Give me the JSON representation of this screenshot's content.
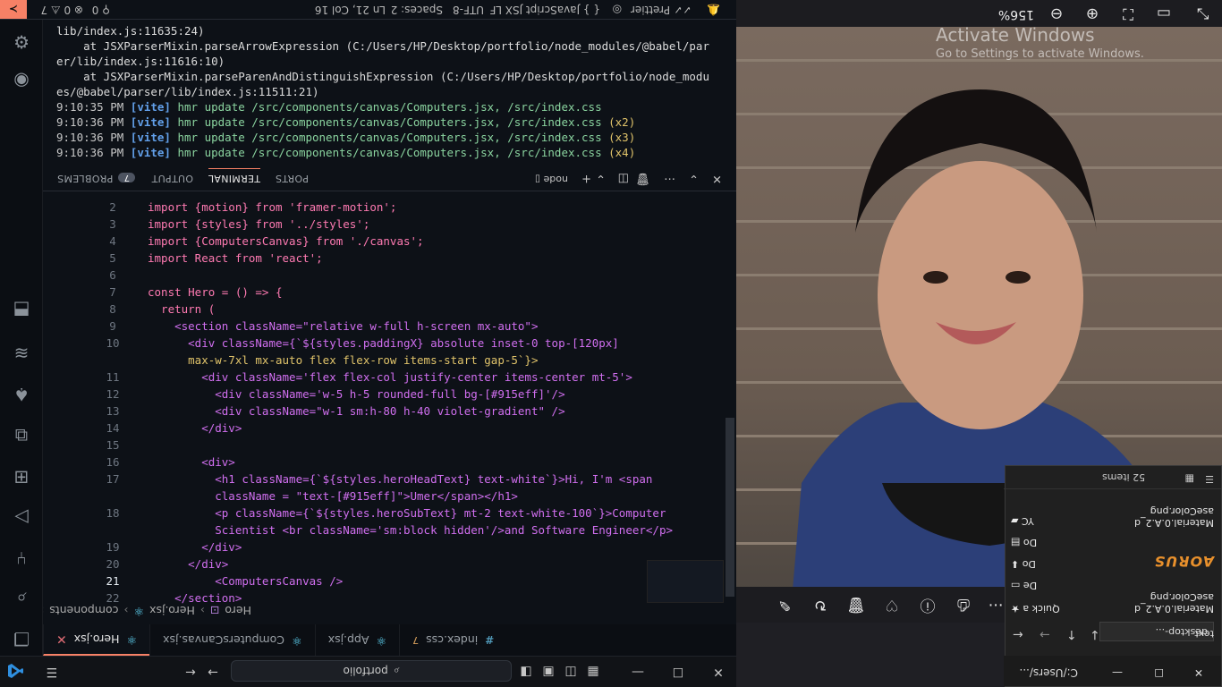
{
  "vscode": {
    "search_text": "portfolio",
    "tabs": [
      {
        "label": "Hero.jsx",
        "active": true
      },
      {
        "label": "ComputersCanvas.jsx"
      },
      {
        "label": "App.jsx"
      },
      {
        "label": "index.css",
        "modified": "7"
      }
    ],
    "breadcrumb": [
      "src",
      "components",
      "Hero.jsx",
      "Hero"
    ],
    "code": [
      {
        "n": "2",
        "text": "import {motion} from 'framer-motion';"
      },
      {
        "n": "3",
        "text": "import {styles} from '../styles';"
      },
      {
        "n": "4",
        "text": "import {ComputersCanvas} from './canvas';"
      },
      {
        "n": "5",
        "text": "import React from 'react';"
      },
      {
        "n": "6",
        "text": ""
      },
      {
        "n": "7",
        "text": "const Hero = () => {"
      },
      {
        "n": "8",
        "text": "  return ("
      },
      {
        "n": "9",
        "text": "    <section className=\"relative w-full h-screen mx-auto\">"
      },
      {
        "n": "10",
        "text": "      <div className={`${styles.paddingX} absolute inset-0 top-[120px]"
      },
      {
        "n": "",
        "text": "      max-w-7xl mx-auto flex flex-row items-start gap-5`}>"
      },
      {
        "n": "11",
        "text": "        <div className='flex flex-col justify-center items-center mt-5'>"
      },
      {
        "n": "12",
        "text": "          <div className='w-5 h-5 rounded-full bg-[#915eff]'/>"
      },
      {
        "n": "13",
        "text": "          <div className=\"w-1 sm:h-80 h-40 violet-gradient\" />"
      },
      {
        "n": "14",
        "text": "        </div>"
      },
      {
        "n": "15",
        "text": ""
      },
      {
        "n": "16",
        "text": "        <div>"
      },
      {
        "n": "17",
        "text": "          <h1 className={`${styles.heroHeadText} text-white`}>Hi, I'm <span"
      },
      {
        "n": "",
        "text": "          className = \"text-[#915eff]\">Umer</span></h1>"
      },
      {
        "n": "18",
        "text": "          <p className={`${styles.heroSubText} mt-2 text-white-100`}>Computer"
      },
      {
        "n": "",
        "text": "          Scientist <br className='sm:block hidden'/>and Software Engineer</p>"
      },
      {
        "n": "19",
        "text": "        </div>"
      },
      {
        "n": "20",
        "text": "      </div>"
      },
      {
        "n": "21",
        "text": "          <ComputersCanvas />"
      },
      {
        "n": "22",
        "text": "    </section>"
      }
    ],
    "panel_tabs": {
      "problems": "PROBLEMS",
      "problems_count": "7",
      "output": "OUTPUT",
      "terminal": "TERMINAL",
      "ports": "PORTS",
      "shell": "node"
    },
    "terminal": [
      {
        "text": "lib/index.js:11635:24)"
      },
      {
        "text": "    at JSXParserMixin.parseArrowExpression (C:/Users/HP/Desktop/portfolio/node_modules/@babel/par"
      },
      {
        "text": "er/lib/index.js:11616:10)"
      },
      {
        "text": "    at JSXParserMixin.parseParenAndDistinguishExpression (C:/Users/HP/Desktop/portfolio/node_modu"
      },
      {
        "text": "es/@babel/parser/lib/index.js:11511:21)"
      },
      {
        "time": "9:10:35 PM",
        "tag": "[vite]",
        "msg": "hmr update /src/components/canvas/Computers.jsx, /src/index.css",
        "count": ""
      },
      {
        "time": "9:10:36 PM",
        "tag": "[vite]",
        "msg": "hmr update /src/components/canvas/Computers.jsx, /src/index.css",
        "count": "(x2)"
      },
      {
        "time": "9:10:36 PM",
        "tag": "[vite]",
        "msg": "hmr update /src/components/canvas/Computers.jsx, /src/index.css",
        "count": "(x3)"
      },
      {
        "time": "9:10:36 PM",
        "tag": "[vite]",
        "msg": "hmr update /src/components/canvas/Computers.jsx, /src/index.css",
        "count": "(x4)"
      }
    ],
    "status": {
      "errors": "0",
      "warnings": "7",
      "ports": "0",
      "position": "Ln 21, Col 16",
      "spaces": "Spaces: 2",
      "encoding": "UTF-8",
      "eol": "LF",
      "language": "JavaScript JSX",
      "prettier": "Prettier"
    }
  },
  "viewer": {
    "zoom": "156%",
    "activate_title": "Activate Windows",
    "activate_sub": "Go to Settings to activate Windows."
  },
  "explorer": {
    "title": "C:/Users/...",
    "address": "desktop-...",
    "address_right": "text",
    "nav_items": [
      "Quick a",
      "De",
      "Do",
      "Do",
      "YC"
    ],
    "files": [
      {
        "name": "Material.0.A.2_d",
        "sub": "aseColor.png"
      },
      {
        "name": "AORUS",
        "sub": ""
      },
      {
        "name": "Material.0.A.2_d",
        "sub": "aseColor.png"
      }
    ],
    "status": "52 items"
  },
  "colors": {
    "accent": "#f78166",
    "bg": "#0d1117",
    "current_line": "#12324a"
  }
}
